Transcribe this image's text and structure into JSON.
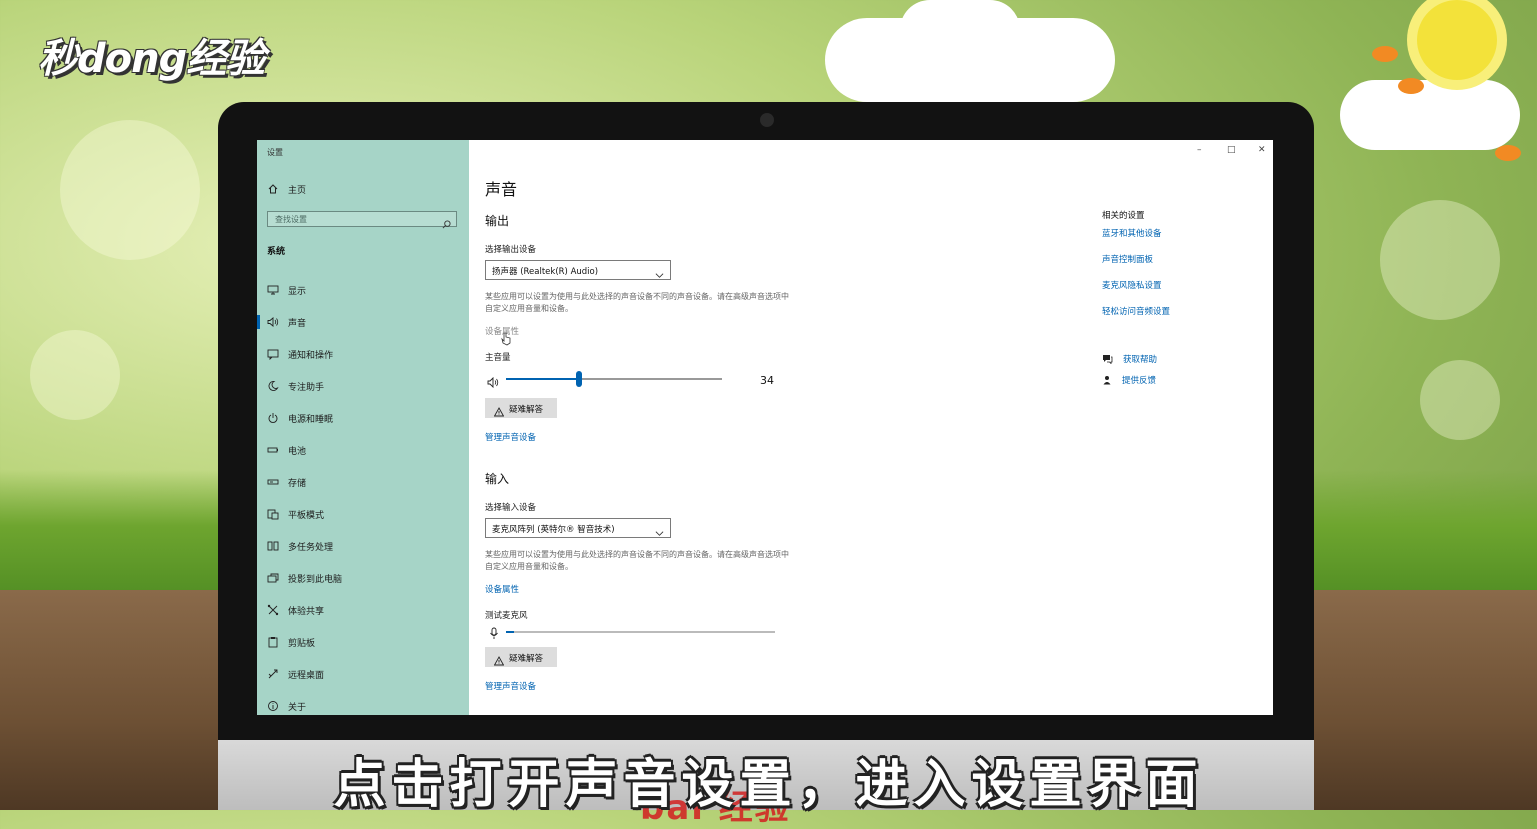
{
  "brand": "秒dong经验",
  "window": {
    "title": "设置",
    "minimize": "–",
    "maximize": "□",
    "close": "✕"
  },
  "sidebar": {
    "home": "主页",
    "search_placeholder": "查找设置",
    "section": "系统",
    "items": [
      {
        "label": "显示",
        "icon": "monitor-icon"
      },
      {
        "label": "声音",
        "icon": "speaker-icon"
      },
      {
        "label": "通知和操作",
        "icon": "notification-icon"
      },
      {
        "label": "专注助手",
        "icon": "moon-icon"
      },
      {
        "label": "电源和睡眠",
        "icon": "power-icon"
      },
      {
        "label": "电池",
        "icon": "battery-icon"
      },
      {
        "label": "存储",
        "icon": "storage-icon"
      },
      {
        "label": "平板模式",
        "icon": "tablet-icon"
      },
      {
        "label": "多任务处理",
        "icon": "multitask-icon"
      },
      {
        "label": "投影到此电脑",
        "icon": "project-icon"
      },
      {
        "label": "体验共享",
        "icon": "share-icon"
      },
      {
        "label": "剪贴板",
        "icon": "clipboard-icon"
      },
      {
        "label": "远程桌面",
        "icon": "remote-icon"
      },
      {
        "label": "关于",
        "icon": "info-icon"
      }
    ]
  },
  "main": {
    "title": "声音",
    "output": {
      "heading": "输出",
      "select_label": "选择输出设备",
      "device": "扬声器 (Realtek(R) Audio)",
      "desc": "某些应用可以设置为使用与此处选择的声音设备不同的声音设备。请在高级声音选项中自定义应用音量和设备。",
      "properties": "设备属性",
      "volume_label": "主音量",
      "volume": 34,
      "volume_text": "34",
      "troubleshoot": "疑难解答",
      "manage": "管理声音设备"
    },
    "input": {
      "heading": "输入",
      "select_label": "选择输入设备",
      "device": "麦克风阵列 (英特尔® 智音技术)",
      "desc": "某些应用可以设置为使用与此处选择的声音设备不同的声音设备。请在高级声音选项中自定义应用音量和设备。",
      "properties": "设备属性",
      "test_label": "测试麦克风",
      "mic_level": 3,
      "troubleshoot": "疑难解答",
      "manage": "管理声音设备"
    }
  },
  "related": {
    "title": "相关的设置",
    "links": [
      "蓝牙和其他设备",
      "声音控制面板",
      "麦克风隐私设置",
      "轻松访问音频设置"
    ],
    "help": "获取帮助",
    "feedback": "提供反馈"
  },
  "caption": "点击打开声音设置，进入设置界面",
  "watermark": "bai 经验",
  "colors": {
    "accent": "#0063b1",
    "sidebar": "#a6d4c7"
  }
}
